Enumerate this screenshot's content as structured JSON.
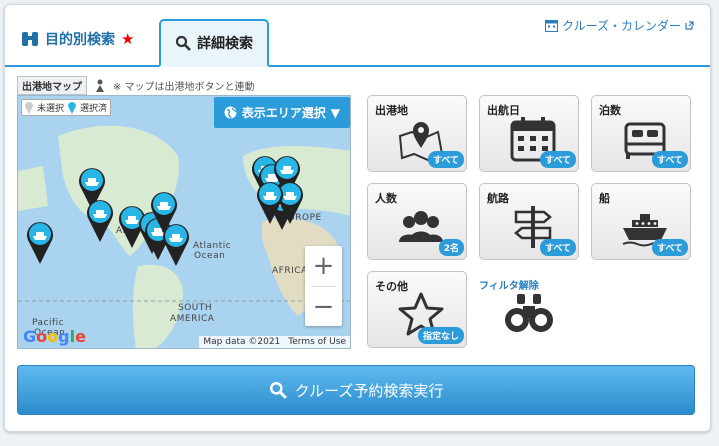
{
  "tabs": {
    "purpose_label": "目的別検索",
    "detail_label": "詳細検索"
  },
  "header": {
    "calendar_label": "クルーズ・カレンダー"
  },
  "map": {
    "title": "出港地マップ",
    "note": "※  マップは出港地ボタンと連動",
    "legend_unselected": "未選択",
    "legend_selected": "選択済",
    "area_select_label": "表示エリア選択",
    "zoom_in": "+",
    "zoom_out": "−",
    "label_atlantic": "Atlantic",
    "label_ocean": "Ocean",
    "label_africa": "AFRICA",
    "label_europe": "EUROPE",
    "label_south": "SOUTH",
    "label_america": "AMERICA",
    "label_pacific": "Pacific",
    "label_ocean2": "Ocean",
    "label_ame": "AME",
    "google": "Google",
    "map_data": "Map data ©2021",
    "terms": "Terms of Use"
  },
  "filters": [
    {
      "label": "出港地",
      "badge": "すべて",
      "icon": "map-icon"
    },
    {
      "label": "出航日",
      "badge": "すべて",
      "icon": "calendar-icon"
    },
    {
      "label": "泊数",
      "badge": "すべて",
      "icon": "bed-icon"
    },
    {
      "label": "人数",
      "badge": "2名",
      "icon": "people-icon"
    },
    {
      "label": "航路",
      "badge": "すべて",
      "icon": "signpost-icon"
    },
    {
      "label": "船",
      "badge": "すべて",
      "icon": "ship-icon"
    },
    {
      "label": "その他",
      "badge": "指定なし",
      "icon": "star-icon"
    }
  ],
  "filter_reset_label": "フィルタ解除",
  "search_button_label": "クルーズ予約検索実行",
  "colors": {
    "accent": "#2b9bd9",
    "pin": "#27b6e6"
  }
}
